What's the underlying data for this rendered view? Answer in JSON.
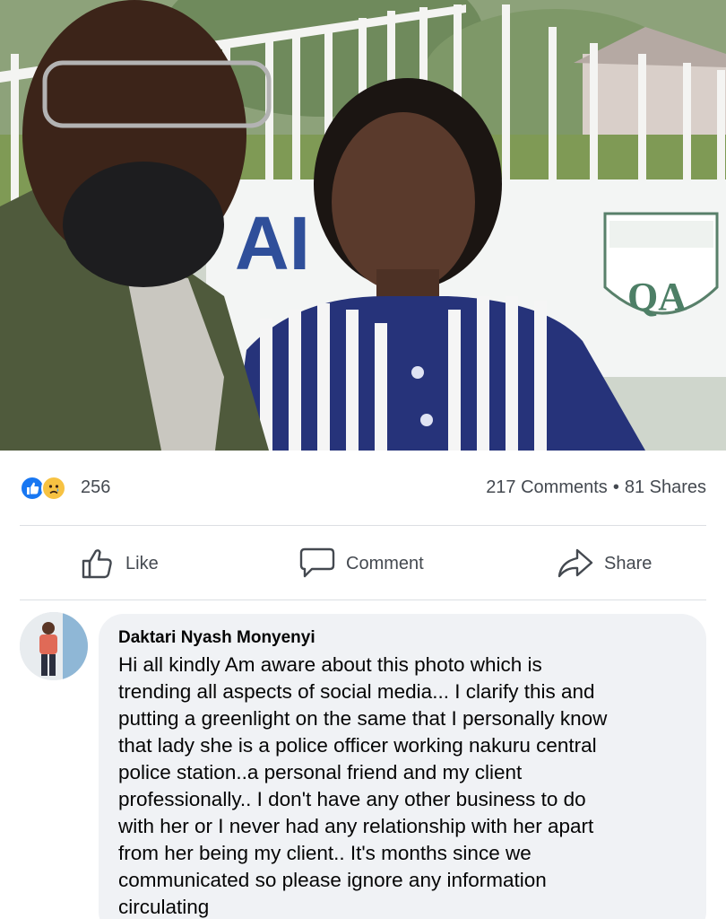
{
  "post": {
    "reactions": {
      "icons": [
        "like-icon",
        "sad-icon"
      ],
      "count": "256"
    },
    "comments_label": "217 Comments",
    "separator": "•",
    "shares_label": "81 Shares",
    "photo": {
      "sign_text": "AI",
      "logo_letters": "QA"
    }
  },
  "actions": {
    "like_label": "Like",
    "comment_label": "Comment",
    "share_label": "Share"
  },
  "comment": {
    "author": "Daktari Nyash Monyenyi",
    "lines": [
      "Hi all kindly Am aware about this photo which is",
      "trending all aspects of social media... I clarify this and",
      "putting a greenlight on the same that I personally know",
      "that lady she is a police officer working nakuru central",
      "police station..a personal friend and my client",
      "professionally.. I don't have any other business to do",
      "with her or I never had any relationship with her apart",
      "from her being my client.. It's months since we",
      "communicated so please ignore any information",
      "circulating"
    ]
  },
  "colors": {
    "like_blue": "#1877f2",
    "sad_yellow": "#f7c242",
    "meta_text": "#444950",
    "bubble_bg": "#f0f2f5"
  }
}
